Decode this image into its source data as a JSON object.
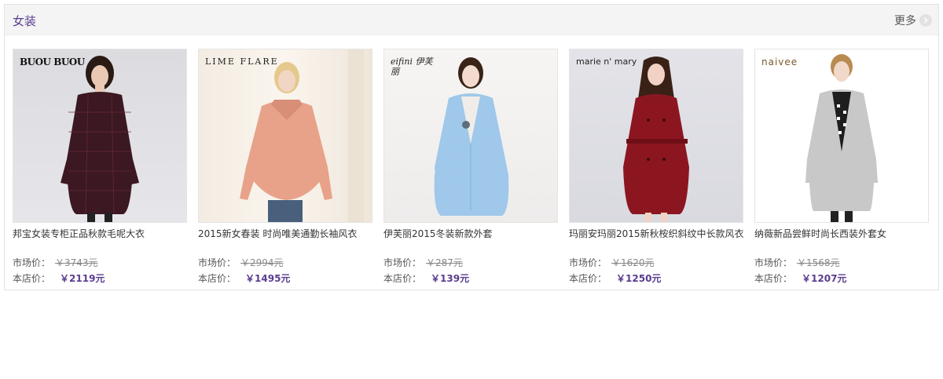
{
  "header": {
    "title": "女装",
    "more_label": "更多"
  },
  "labels": {
    "market": "市场价：",
    "store": "本店价："
  },
  "products": [
    {
      "brand": "BUOU BUOU",
      "name": "邦宝女装专柜正品秋款毛呢大衣",
      "market_price": "￥3743元",
      "store_price": "￥2119元"
    },
    {
      "brand": "LIME FLARE",
      "name": "2015新女春装 时尚唯美通勤长袖风衣",
      "market_price": "￥2994元",
      "store_price": "￥1495元"
    },
    {
      "brand": "eifini 伊芙丽",
      "name": "伊芙丽2015冬装新款外套",
      "market_price": "￥287元",
      "store_price": "￥139元"
    },
    {
      "brand": "marie n' mary",
      "name": "玛丽安玛丽2015新秋桉织斜纹中长款风衣",
      "market_price": "￥1620元",
      "store_price": "￥1250元"
    },
    {
      "brand": "naivee",
      "name": "纳薇新品尝鲜时尚长西装外套女",
      "market_price": "￥1568元",
      "store_price": "￥1207元"
    }
  ]
}
